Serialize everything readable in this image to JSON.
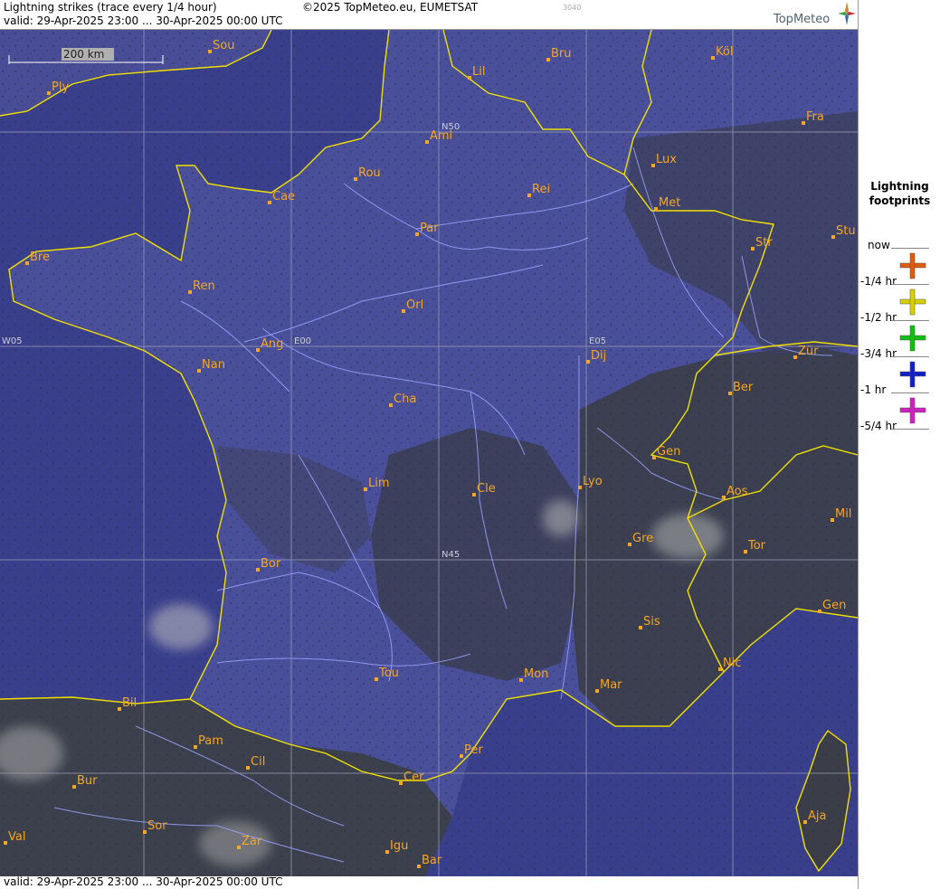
{
  "header": {
    "title": "Lightning strikes (trace every 1/4 hour)",
    "copyright": "©2025 TopMeteo.eu, EUMETSAT",
    "code": "3040",
    "valid": "valid:  29-Apr-2025 23:00 ... 30-Apr-2025 00:00 UTC",
    "logo": "TopMeteo"
  },
  "footer": {
    "valid": "valid:  29-Apr-2025 23:00 ... 30-Apr-2025 00:00 UTC"
  },
  "map": {
    "scale_label": "200 km",
    "grid_labels": {
      "n50": "N50",
      "n45": "N45",
      "w05": "W05",
      "e00": "E00",
      "e05": "E05"
    },
    "cities": [
      {
        "id": "sou",
        "name": "Sou"
      },
      {
        "id": "ply",
        "name": "Ply"
      },
      {
        "id": "lil",
        "name": "Lil"
      },
      {
        "id": "bru",
        "name": "Bru"
      },
      {
        "id": "kol",
        "name": "Köl"
      },
      {
        "id": "ami",
        "name": "Ami"
      },
      {
        "id": "fra",
        "name": "Fra"
      },
      {
        "id": "rou",
        "name": "Rou"
      },
      {
        "id": "lux",
        "name": "Lux"
      },
      {
        "id": "cae",
        "name": "Cae"
      },
      {
        "id": "rei",
        "name": "Rei"
      },
      {
        "id": "met",
        "name": "Met"
      },
      {
        "id": "par",
        "name": "Par"
      },
      {
        "id": "stu",
        "name": "Stu"
      },
      {
        "id": "bre",
        "name": "Bre"
      },
      {
        "id": "str",
        "name": "Str"
      },
      {
        "id": "ren",
        "name": "Ren"
      },
      {
        "id": "orl",
        "name": "Orl"
      },
      {
        "id": "ang",
        "name": "Ang"
      },
      {
        "id": "dij",
        "name": "Dij"
      },
      {
        "id": "zur",
        "name": "Zür"
      },
      {
        "id": "nan",
        "name": "Nan"
      },
      {
        "id": "ber",
        "name": "Ber"
      },
      {
        "id": "cha",
        "name": "Cha"
      },
      {
        "id": "gen",
        "name": "Gen"
      },
      {
        "id": "lim",
        "name": "Lim"
      },
      {
        "id": "lyo",
        "name": "Lyo"
      },
      {
        "id": "cle",
        "name": "Cle"
      },
      {
        "id": "aos",
        "name": "Aos"
      },
      {
        "id": "mil",
        "name": "Mil"
      },
      {
        "id": "gre",
        "name": "Gre"
      },
      {
        "id": "tor",
        "name": "Tor"
      },
      {
        "id": "bor",
        "name": "Bor"
      },
      {
        "id": "gen2",
        "name": "Gen"
      },
      {
        "id": "sis",
        "name": "Sis"
      },
      {
        "id": "nic",
        "name": "Nic"
      },
      {
        "id": "tou",
        "name": "Tou"
      },
      {
        "id": "mon",
        "name": "Mon"
      },
      {
        "id": "mar",
        "name": "Mar"
      },
      {
        "id": "bil",
        "name": "Bil"
      },
      {
        "id": "pam",
        "name": "Pam"
      },
      {
        "id": "per",
        "name": "Per"
      },
      {
        "id": "cil",
        "name": "Cil"
      },
      {
        "id": "cer",
        "name": "Cer"
      },
      {
        "id": "bur",
        "name": "Bur"
      },
      {
        "id": "aja",
        "name": "Aja"
      },
      {
        "id": "sor",
        "name": "Sor"
      },
      {
        "id": "val",
        "name": "Val"
      },
      {
        "id": "zar",
        "name": "Zar"
      },
      {
        "id": "igu",
        "name": "Igu"
      },
      {
        "id": "bar",
        "name": "Bar"
      }
    ]
  },
  "legend": {
    "title_line1": "Lightning",
    "title_line2": "footprints",
    "items": [
      {
        "label": "now",
        "color": "#e05a10"
      },
      {
        "label": "-1/4 hr",
        "color": "#d8d000"
      },
      {
        "label": "-1/2 hr",
        "color": "#10c010"
      },
      {
        "label": "-3/4 hr",
        "color": "#1020c8"
      },
      {
        "label": "-1 hr",
        "color": "#d020c0"
      },
      {
        "label": "-5/4 hr",
        "color": ""
      }
    ]
  },
  "colors": {
    "sea": "#3a3f8c",
    "land": "#4a4f9a",
    "border": "#f0e000",
    "river": "#9aa4ff",
    "grid": "#a0a4b8",
    "city": "#f5a623"
  }
}
